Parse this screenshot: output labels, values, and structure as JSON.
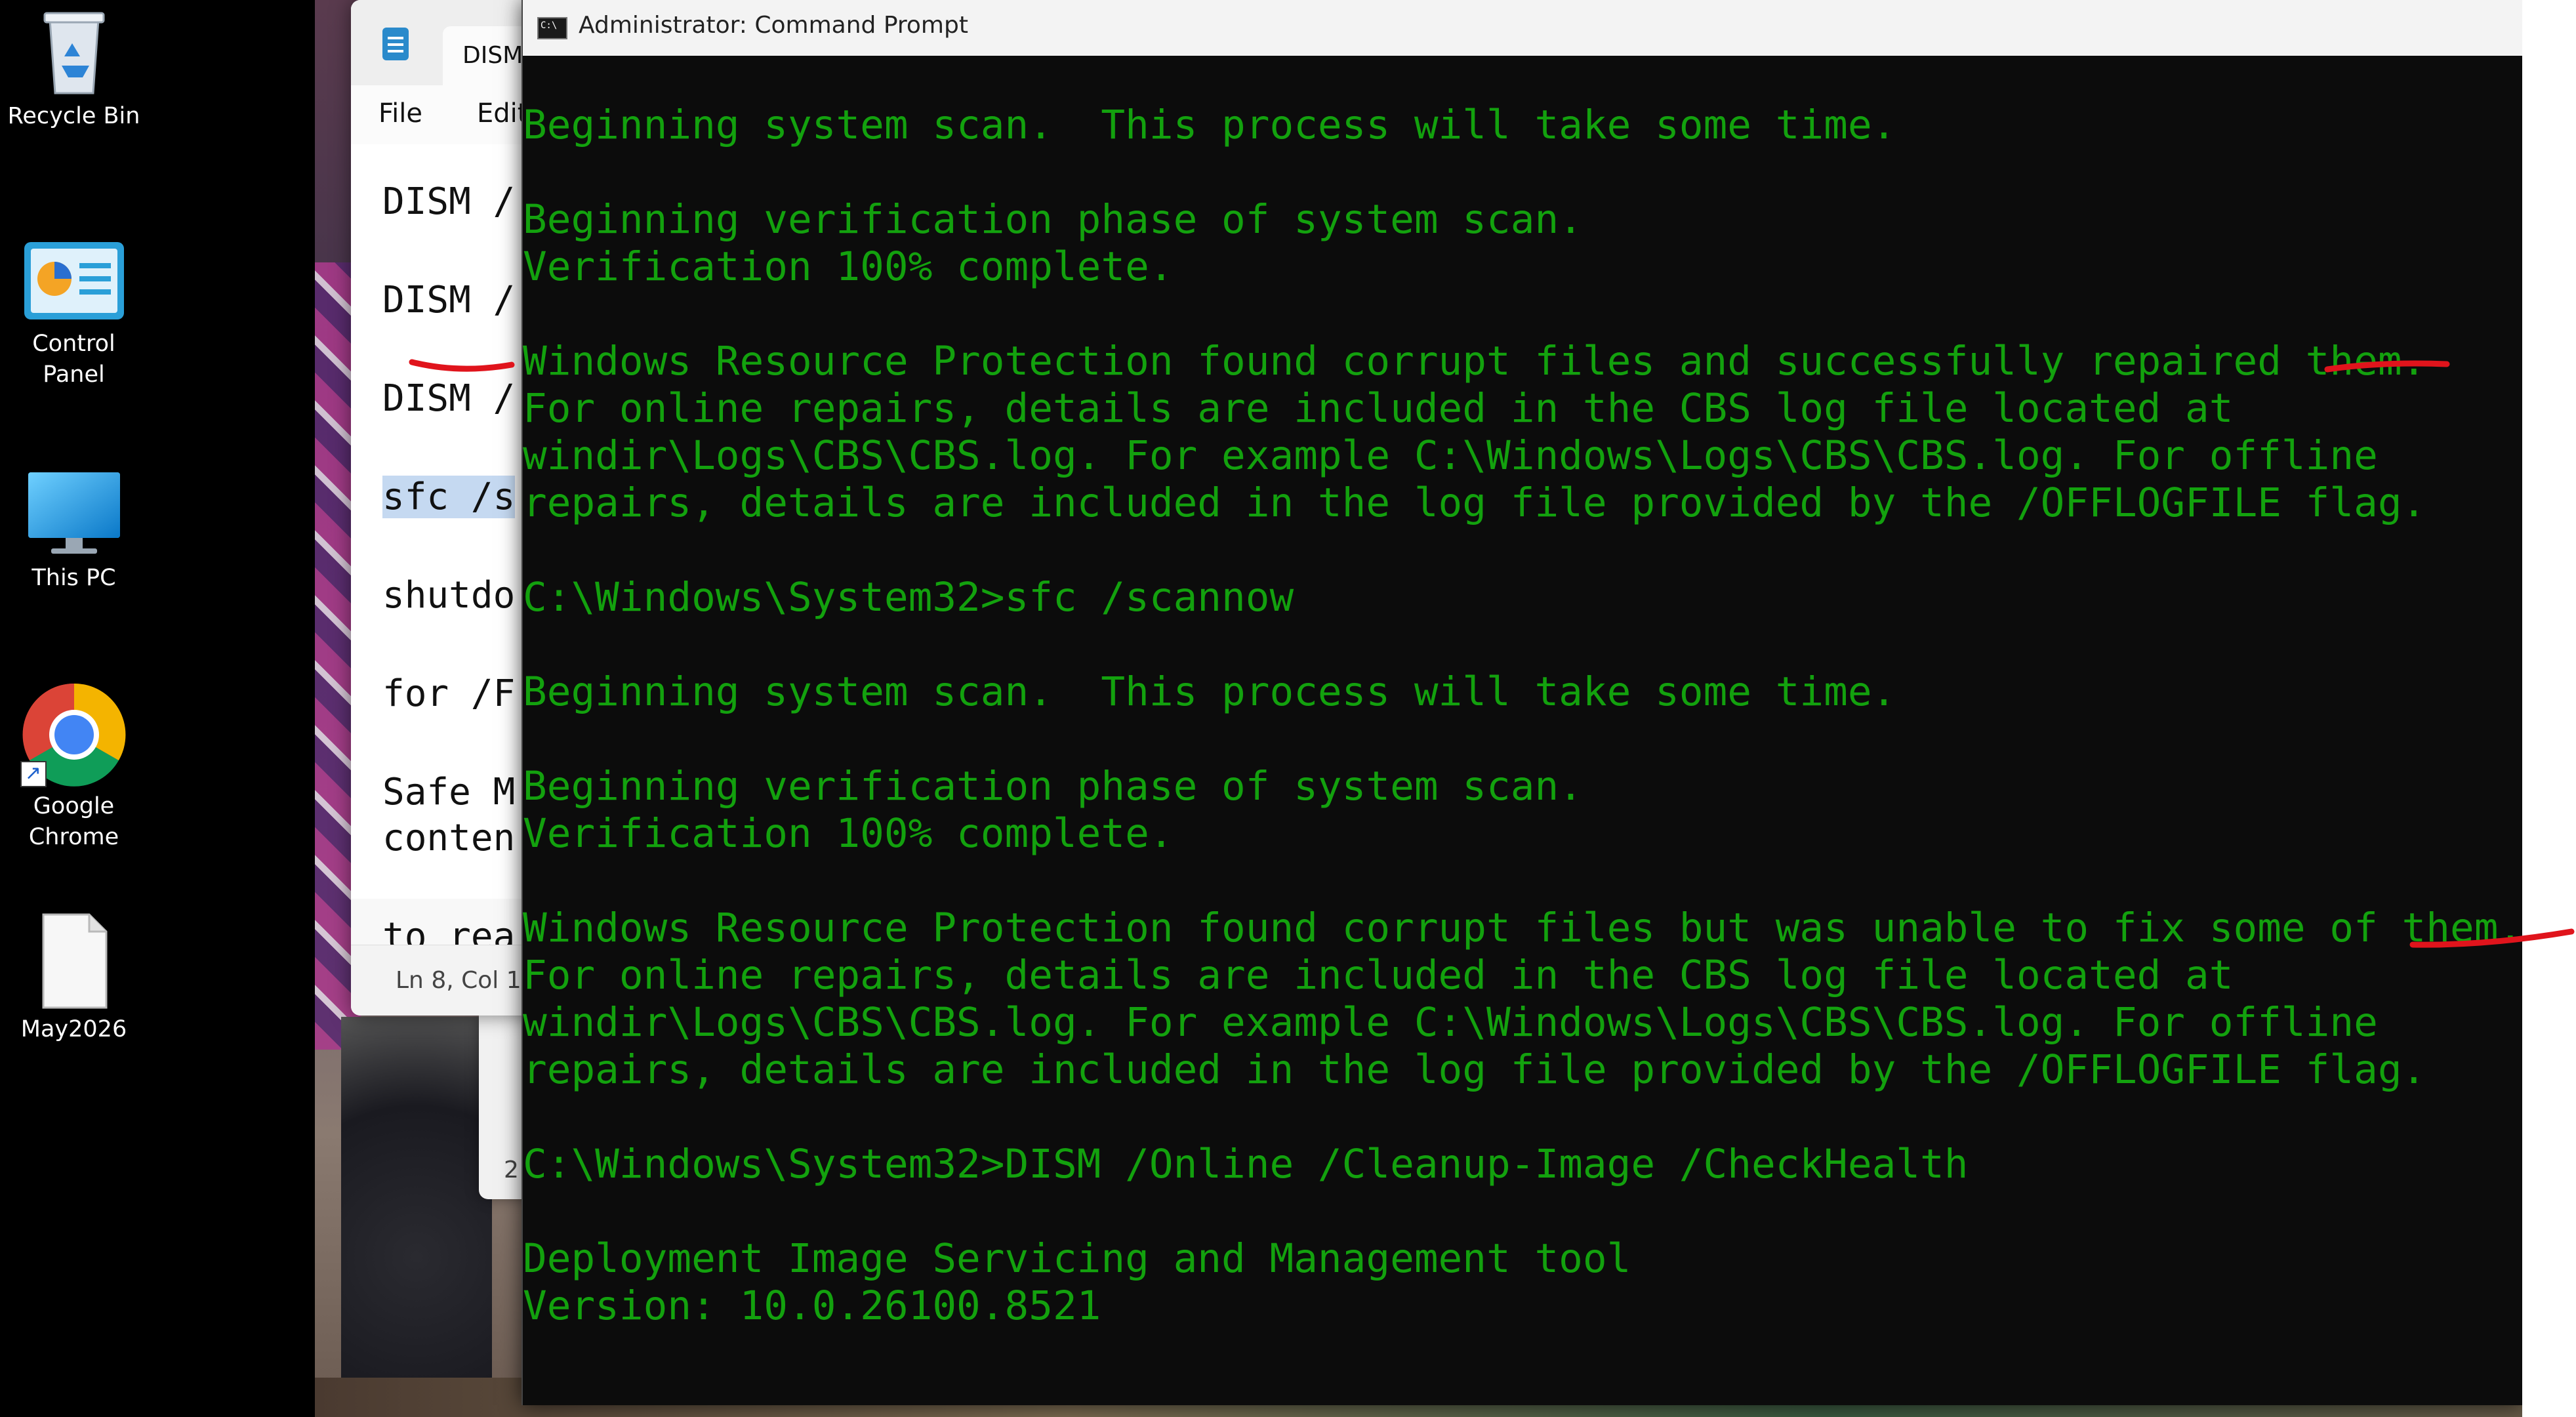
{
  "desktop": {
    "icons": [
      {
        "label": "Recycle Bin",
        "icon": "recycle-bin-icon"
      },
      {
        "label": "Control Panel",
        "icon": "control-panel-icon"
      },
      {
        "label": "This PC",
        "icon": "this-pc-icon"
      },
      {
        "label": "Google\nChrome",
        "icon": "chrome-icon"
      },
      {
        "label": "May2026",
        "icon": "text-file-icon"
      }
    ]
  },
  "notepad": {
    "tab_title": "DISM",
    "menu": {
      "file": "File",
      "edit": "Edit"
    },
    "lines": [
      "DISM /",
      "DISM /(",
      "DISM /",
      "sfc /s",
      "shutdo",
      "for /F",
      "Safe M",
      "conten",
      "to rea"
    ],
    "status": "Ln 8, Col 1",
    "second_status": "2"
  },
  "cmd": {
    "title": "Administrator: Command Prompt",
    "text_color": "#13a10e",
    "lines": [
      "Beginning system scan.  This process will take some time.",
      "",
      "Beginning verification phase of system scan.",
      "Verification 100% complete.",
      "",
      "Windows Resource Protection found corrupt files and successfully repaired them.",
      "For online repairs, details are included in the CBS log file located at",
      "windir\\Logs\\CBS\\CBS.log. For example C:\\Windows\\Logs\\CBS\\CBS.log. For offline",
      "repairs, details are included in the log file provided by the /OFFLOGFILE flag.",
      "",
      "C:\\Windows\\System32>sfc /scannow",
      "",
      "Beginning system scan.  This process will take some time.",
      "",
      "Beginning verification phase of system scan.",
      "Verification 100% complete.",
      "",
      "Windows Resource Protection found corrupt files but was unable to fix some of them.",
      "For online repairs, details are included in the CBS log file located at",
      "windir\\Logs\\CBS\\CBS.log. For example C:\\Windows\\Logs\\CBS\\CBS.log. For offline",
      "repairs, details are included in the log file provided by the /OFFLOGFILE flag.",
      "",
      "C:\\Windows\\System32>DISM /Online /Cleanup-Image /CheckHealth",
      "",
      "Deployment Image Servicing and Management tool",
      "Version: 10.0.26100.8521"
    ]
  },
  "annotations": {
    "color": "#e0141c"
  }
}
